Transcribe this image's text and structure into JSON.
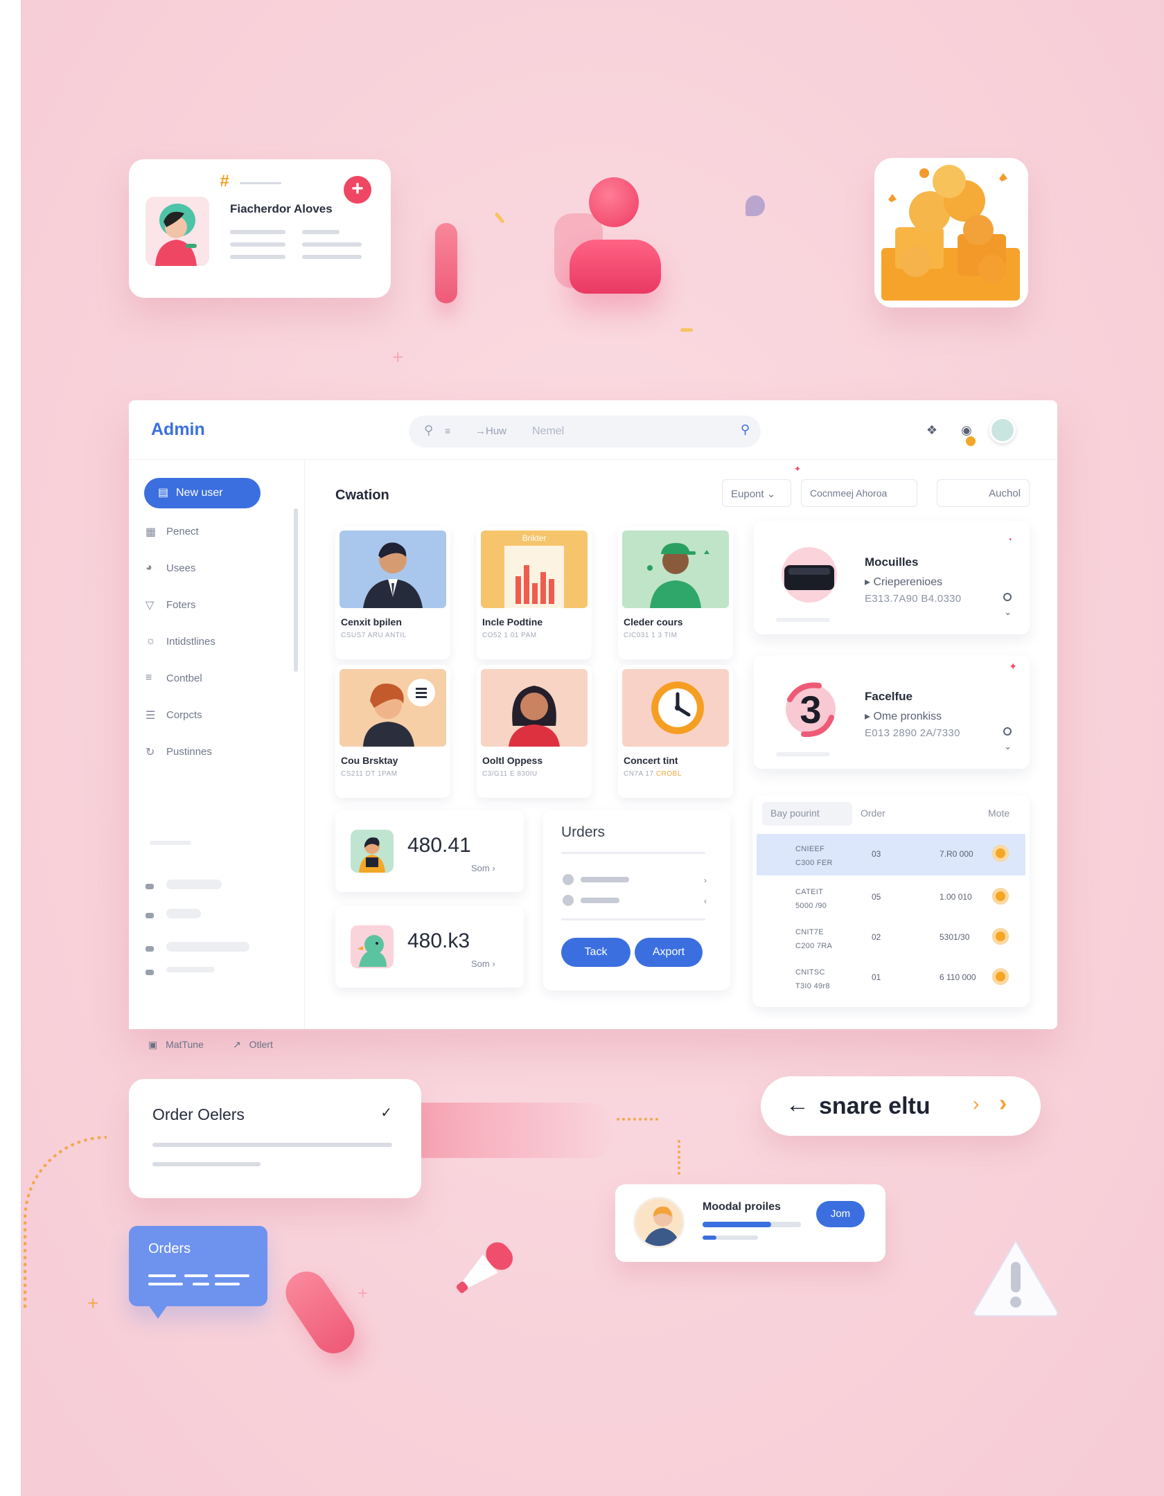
{
  "profile_card": {
    "name": "Fiacherdor Aloves"
  },
  "window": {
    "brand": "Admin",
    "search": {
      "left_text": "→Huw",
      "placeholder": "Nemel"
    },
    "sidebar": {
      "new_user_label": "New user",
      "items": [
        {
          "label": "Penect",
          "icon": "document-icon"
        },
        {
          "label": "Usees",
          "icon": "users-icon"
        },
        {
          "label": "Foters",
          "icon": "filter-icon"
        },
        {
          "label": "Intidstlines",
          "icon": "settings-icon"
        },
        {
          "label": "Contbel",
          "icon": "list-icon"
        },
        {
          "label": "Corpcts",
          "icon": "lines-icon"
        },
        {
          "label": "Pustinnes",
          "icon": "refresh-icon"
        }
      ],
      "footer": [
        {
          "label": "MatTune",
          "icon": "calendar-icon"
        },
        {
          "label": "Otlert",
          "icon": "export-icon"
        }
      ]
    },
    "section_title": "Cwation",
    "header_buttons": {
      "export": "Eupont",
      "compare": "Cocnmeej Ahoroa",
      "archive": "Auchol"
    },
    "tiles": [
      {
        "title": "Cenxit bpilen",
        "sub": "CSUS7 ARU ANTIL",
        "bg": "#a9c7ec",
        "icon": "man-avatar-icon"
      },
      {
        "title": "Incle Podtine",
        "sub": "CO52 1 01 PAM",
        "bg": "#f6c56b",
        "icon": "bar-chart-icon",
        "banner": "Brikter"
      },
      {
        "title": "Cleder cours",
        "sub": "CIC031 1 3 TIM",
        "bg": "#bfe4c8",
        "icon": "man-cap-avatar-icon"
      },
      {
        "title": "Cou Brsktay",
        "sub": "CS211 DT 1PAM",
        "bg": "#f7cfa7",
        "icon": "woman-chat-avatar-icon"
      },
      {
        "title": "Ooltl Oppess",
        "sub": "C3/G11 E 830IU",
        "bg": "#f8d4c4",
        "icon": "woman-avatar-icon"
      },
      {
        "title": "Concert tint",
        "sub": "CN7A 17",
        "sub_accent": "CROBL",
        "bg": "#f9d2c7",
        "icon": "clock-icon"
      }
    ],
    "right_cards": [
      {
        "title": "Mocuilles",
        "sub": "Crieperenioes",
        "nums": "E313.7A90   B4.0330",
        "icon": "headset-icon"
      },
      {
        "title": "Facelfue",
        "sub": "Ome pronkiss",
        "nums": "E013 2890   2A/7330",
        "icon": "number-three-icon"
      }
    ],
    "stats": [
      {
        "value": "480.41",
        "link": "Som"
      },
      {
        "value": "480.k3",
        "link": "Som"
      }
    ],
    "orders_panel": {
      "title": "Urders",
      "btn_track": "Tack",
      "btn_export": "Axport"
    },
    "table": {
      "headers": [
        "Bay pourint",
        "Order",
        "Mote"
      ],
      "rows": [
        {
          "c1a": "CNIEEF",
          "c1b": "C300 FER",
          "c2": "03",
          "c3": "7.R0 000",
          "selected": true
        },
        {
          "c1a": "CATEIT",
          "c1b": "5000 /90",
          "c2": "05",
          "c3": "1.00 010",
          "selected": false
        },
        {
          "c1a": "CNIT7E",
          "c1b": "C200 7RA",
          "c2": "02",
          "c3": "5301/30",
          "selected": false
        },
        {
          "c1a": "CNITSC",
          "c1b": "T3I0 49r8",
          "c2": "01",
          "c3": "6 110 000",
          "selected": false
        }
      ]
    }
  },
  "order_card": {
    "title": "Order Oelers"
  },
  "nav_pill": {
    "title": "snare eltu"
  },
  "model_card": {
    "title": "Moodal proiles",
    "join_label": "Jom",
    "progress_top": 0.7,
    "progress_bottom": 0.25
  },
  "orders_bubble": {
    "title": "Orders"
  },
  "colors": {
    "accent": "#3b6fe0",
    "brand_pink": "#ef4763",
    "warning_orange": "#f6a625",
    "background": "#f9d7de"
  }
}
